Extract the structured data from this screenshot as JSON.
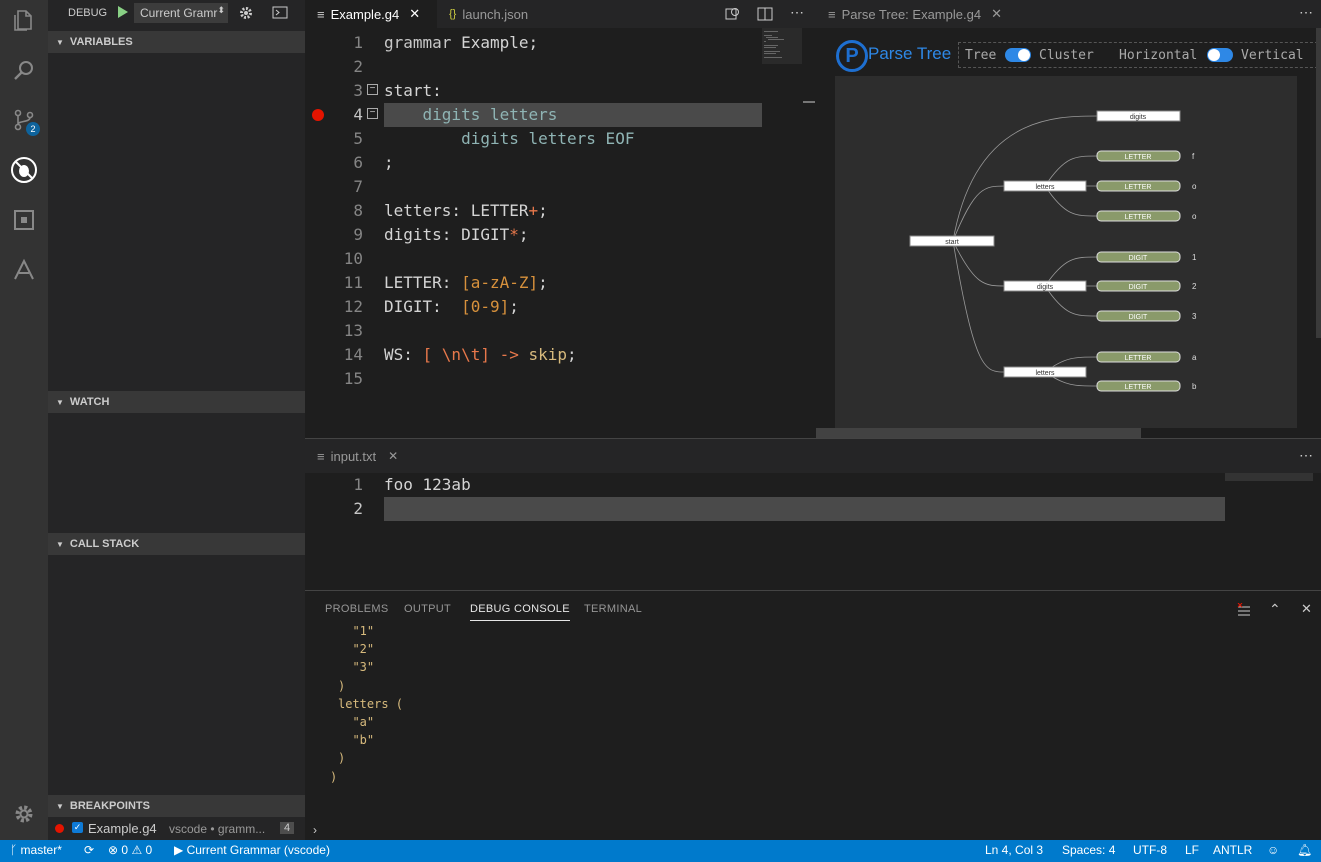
{
  "debug": {
    "title": "DEBUG",
    "config": "Current Gramr"
  },
  "activity": {
    "scm_badge": "2"
  },
  "sections": {
    "variables": "VARIABLES",
    "watch": "WATCH",
    "call_stack": "CALL STACK",
    "breakpoints": "BREAKPOINTS"
  },
  "breakpoint": {
    "file": "Example.g4",
    "path": "vscode • gramm...",
    "line": "4"
  },
  "tabs": {
    "editor": "Example.g4",
    "launch": "launch.json",
    "parse_tree": "Parse Tree: Example.g4",
    "input": "input.txt"
  },
  "code": {
    "line_numbers": [
      "1",
      "2",
      "3",
      "4",
      "5",
      "6",
      "7",
      "8",
      "9",
      "10",
      "11",
      "12",
      "13",
      "14",
      "15"
    ],
    "l1a": "grammar",
    "l1b": " Example;",
    "l3": "start:",
    "l4": "    digits letters",
    "l5": "        digits letters EOF",
    "l6": ";",
    "l8a": "letters: LETTER",
    "l8b": "+",
    "l8c": ";",
    "l9a": "digits: DIGIT",
    "l9b": "*",
    "l9c": ";",
    "l11a": "LETTER: ",
    "l11b": "[a-zA-Z]",
    "l11c": ";",
    "l12a": "DIGIT:  ",
    "l12b": "[0-9]",
    "l12c": ";",
    "l14a": "WS: ",
    "l14b": "[ \\n\\t]",
    "l14c": " ->",
    "l14d": " skip",
    ";": ";"
  },
  "parse_tree": {
    "header": "Parse Tree",
    "tree_label": "Tree",
    "cluster_label": "Cluster",
    "horizontal_label": "Horizontal",
    "vertical_label": "Vertical",
    "nodes": {
      "start": "start",
      "digits_top": "digits",
      "letters1": "letters",
      "digits2": "digits",
      "letters2": "letters"
    },
    "leaves": [
      "LETTER",
      "LETTER",
      "LETTER",
      "DIGIT",
      "DIGIT",
      "DIGIT",
      "LETTER",
      "LETTER"
    ],
    "tokens": [
      "f",
      "o",
      "o",
      "1",
      "2",
      "3",
      "a",
      "b"
    ]
  },
  "input": {
    "line_numbers": [
      "1",
      "2"
    ],
    "line1": "foo 123ab"
  },
  "panel": {
    "tabs": [
      "PROBLEMS",
      "OUTPUT",
      "DEBUG CONSOLE",
      "TERMINAL"
    ],
    "console": [
      "  \"1\"",
      "  \"2\"",
      "  \"3\"",
      ")",
      "letters (",
      "  \"a\"",
      "  \"b\"",
      ")",
      ")"
    ]
  },
  "status": {
    "branch": "master*",
    "errors": "0",
    "warnings": "0",
    "launch": "Current Grammar (vscode)",
    "position": "Ln 4, Col 3",
    "spaces": "Spaces: 4",
    "encoding": "UTF-8",
    "eol": "LF",
    "language": "ANTLR"
  },
  "colors": {
    "accent": "#007acc",
    "breakpoint": "#e51400",
    "leaf": "#8a9a6a"
  }
}
